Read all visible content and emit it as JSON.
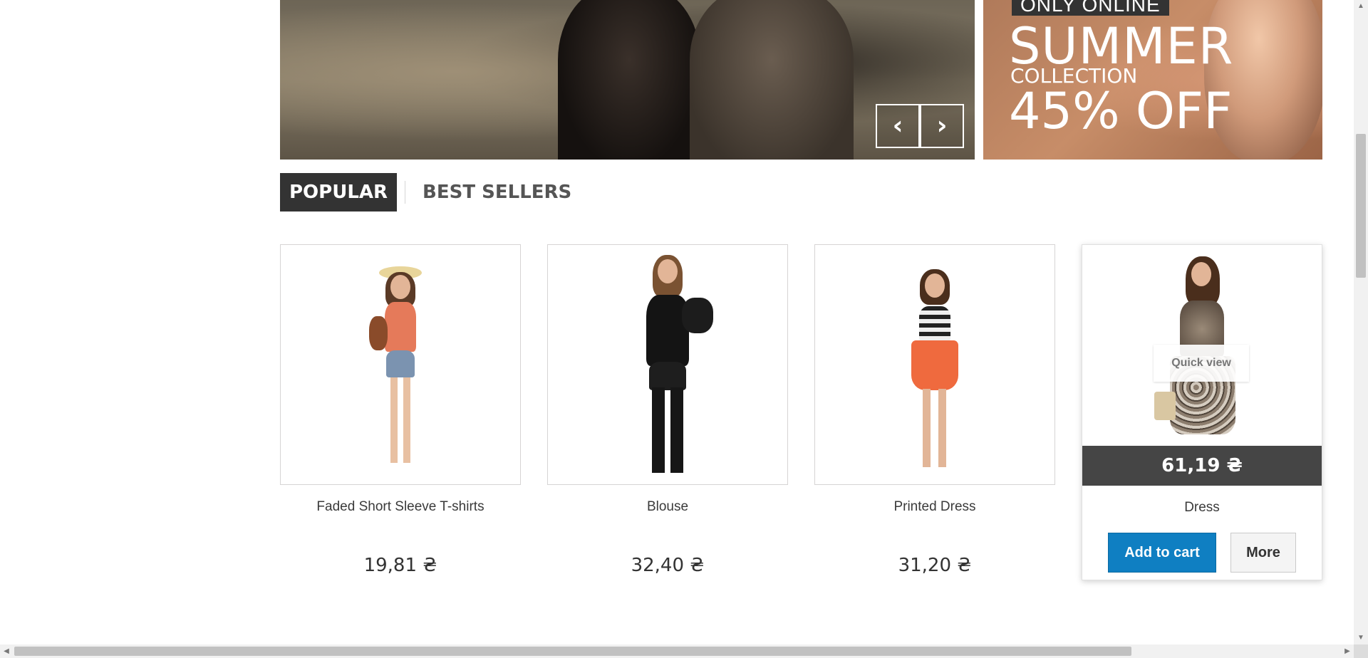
{
  "banners": {
    "main": {
      "prev_icon": "chevron-left-icon",
      "next_icon": "chevron-right-icon",
      "prev_glyph": "‹",
      "next_glyph": "›"
    },
    "side": {
      "badge": "ONLY ONLINE",
      "headline": "SUMMER",
      "subline": "COLLECTION",
      "discount": "45% OFF"
    }
  },
  "tabs": [
    {
      "label": "POPULAR",
      "active": true
    },
    {
      "label": "BEST SELLERS",
      "active": false
    }
  ],
  "products": [
    {
      "name": "Faded Short Sleeve T-shirts",
      "price": "19,81 ₴"
    },
    {
      "name": "Blouse",
      "price": "32,40 ₴"
    },
    {
      "name": "Printed Dress",
      "price": "31,20 ₴"
    },
    {
      "name": "Dress",
      "price": "61,19 ₴",
      "quick_view": "Quick view",
      "add_to_cart": "Add to cart",
      "more": "More"
    }
  ],
  "colors": {
    "accent": "#0f7fc2",
    "dark": "#333333",
    "price_bar": "#454545"
  },
  "scrollbars": {
    "up_arrow": "▲",
    "down_arrow": "▼",
    "left_arrow": "◀",
    "right_arrow": "▶"
  }
}
